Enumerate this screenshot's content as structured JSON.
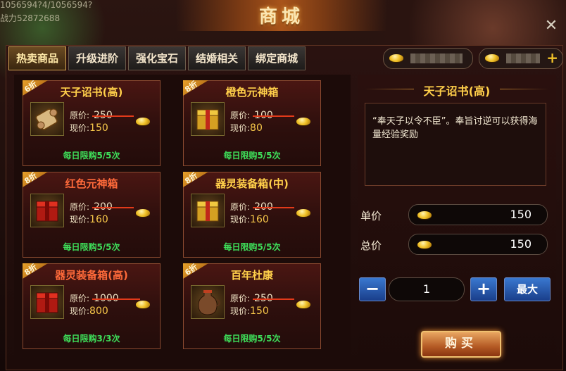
{
  "background": {
    "top_left_text": [
      "1056594?4/1056594?",
      "战力52872688"
    ]
  },
  "window": {
    "title": "商城"
  },
  "tabs": [
    "热卖商品",
    "升级进阶",
    "强化宝石",
    "结婚相关",
    "绑定商城"
  ],
  "active_tab_index": 0,
  "items": [
    {
      "name": "天子诏书(高)",
      "discount": "6折",
      "orig_label": "原价:",
      "orig_price": "250",
      "now_label": "现价:",
      "now_price": "150",
      "limit": "每日限购5/5次",
      "name_color": "gold",
      "icon": "scroll-icon"
    },
    {
      "name": "橙色元神箱",
      "discount": "8折",
      "orig_label": "原价:",
      "orig_price": "100",
      "now_label": "现价:",
      "now_price": "80",
      "limit": "每日限购5/5次",
      "name_color": "gold",
      "icon": "gold-chest-icon"
    },
    {
      "name": "红色元神箱",
      "discount": "8折",
      "orig_label": "原价:",
      "orig_price": "200",
      "now_label": "现价:",
      "now_price": "160",
      "limit": "每日限购5/5次",
      "name_color": "red",
      "icon": "red-chest-icon"
    },
    {
      "name": "器灵装备箱(中)",
      "discount": "8折",
      "orig_label": "原价:",
      "orig_price": "200",
      "now_label": "现价:",
      "now_price": "160",
      "limit": "每日限购5/5次",
      "name_color": "gold",
      "icon": "gold-chest-icon"
    },
    {
      "name": "器灵装备箱(高)",
      "discount": "8折",
      "orig_label": "原价:",
      "orig_price": "1000",
      "now_label": "现价:",
      "now_price": "800",
      "limit": "每日限购3/3次",
      "name_color": "red",
      "icon": "red-chest-icon"
    },
    {
      "name": "百年杜康",
      "discount": "6折",
      "orig_label": "原价:",
      "orig_price": "250",
      "now_label": "现价:",
      "now_price": "150",
      "limit": "每日限购5/5次",
      "name_color": "gold",
      "icon": "wine-jug-icon"
    }
  ],
  "detail": {
    "name": "天子诏书(高)",
    "description": "“奉天子以令不臣”。奉旨讨逆可以获得海量经验奖励",
    "unit_price_label": "单价",
    "unit_price": "150",
    "total_label": "总价",
    "total": "150",
    "minus": "−",
    "quantity": "1",
    "plus": "+",
    "max_label": "最大",
    "buy_label": "购买"
  },
  "colors": {
    "accent_gold": "#ffcf4a",
    "discount_orange": "#e6a02a",
    "limit_green": "#3ee05a",
    "strike_red": "#e23a1a"
  }
}
